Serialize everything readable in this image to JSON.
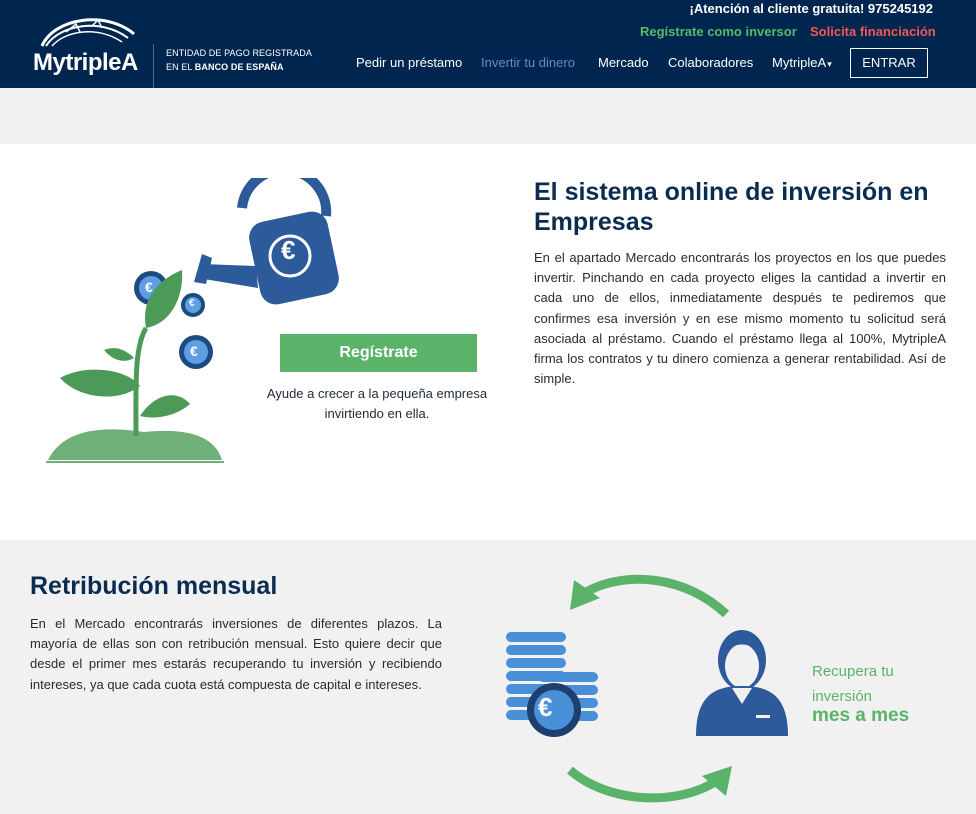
{
  "header": {
    "logo_text": "MytripleA",
    "entity_line1": "ENTIDAD DE PAGO REGISTRADA",
    "entity_line2_prefix": "EN EL ",
    "entity_line2_bold": "BANCO DE ESPAÑA",
    "attention": "¡Atención al cliente gratuita! 975245192",
    "register_investor": "Regístrate como inversor",
    "request_financing": "Solicita financiación",
    "nav": {
      "loan": "Pedir un préstamo",
      "invest": "Invertir tu dinero",
      "market": "Mercado",
      "partners": "Colaboradores",
      "company": "MytripleA",
      "enter": "ENTRAR"
    }
  },
  "section1": {
    "title": "El sistema online de inversión en Empresas",
    "body": "En el apartado Mercado encontrarás los proyectos en los que puedes invertir. Pinchando en cada proyecto eliges la cantidad a invertir en cada uno de ellos, inmediatamente después te pediremos que confirmes esa inversión y en ese mismo momento tu solicitud será asociada al préstamo. Cuando el préstamo llega al 100%, MytripleA firma los contratos y tu dinero comienza a generar rentabilidad. Así de simple.",
    "register_button": "Regístrate",
    "caption": "Ayude a crecer a la pequeña empresa invirtiendo en ella."
  },
  "section2": {
    "title": "Retribución mensual",
    "body": "En el Mercado encontrarás inversiones de diferentes plazos. La mayoría de ellas son con retribución mensual. Esto quiere decir que desde el primer mes estarás recuperando tu inversión y recibiendo intereses, ya que cada cuota está compuesta de capital e intereses.",
    "recover_line1": "Recupera tu",
    "recover_line2": "inversión",
    "recover_bold": "mes a mes"
  },
  "symbols": {
    "euro": "€"
  },
  "colors": {
    "header_bg": "#00264f",
    "brand_green": "#5bb36a",
    "brand_red": "#f05a55",
    "nav_active": "#5e8fc6",
    "icon_blue": "#2d5a9a",
    "coin_blue": "#4a90d9"
  }
}
